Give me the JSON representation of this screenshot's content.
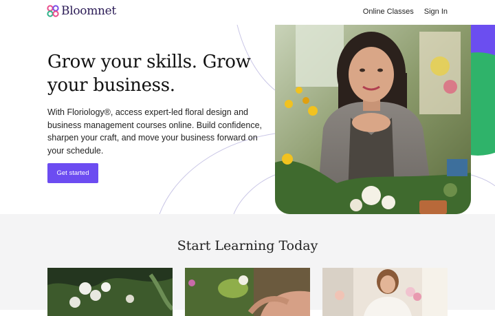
{
  "brand": {
    "name": "Bloomnet",
    "logo_icon": "flower-logo-icon",
    "logo_colors": [
      "#e94c8a",
      "#2fb38a",
      "#7b4de6"
    ]
  },
  "nav": {
    "items": [
      "Online Classes",
      "Sign In"
    ]
  },
  "hero": {
    "title": "Grow your skills. Grow your business.",
    "body": "With Floriology®, access expert-led floral design and business management courses online. Build confidence, sharpen your craft, and move your business forward on your schedule.",
    "cta_label": "Get started"
  },
  "learning": {
    "title": "Start Learning Today"
  },
  "colors": {
    "accent": "#6c4cf1",
    "green": "#2fb36a",
    "section_bg": "#f4f4f5"
  }
}
